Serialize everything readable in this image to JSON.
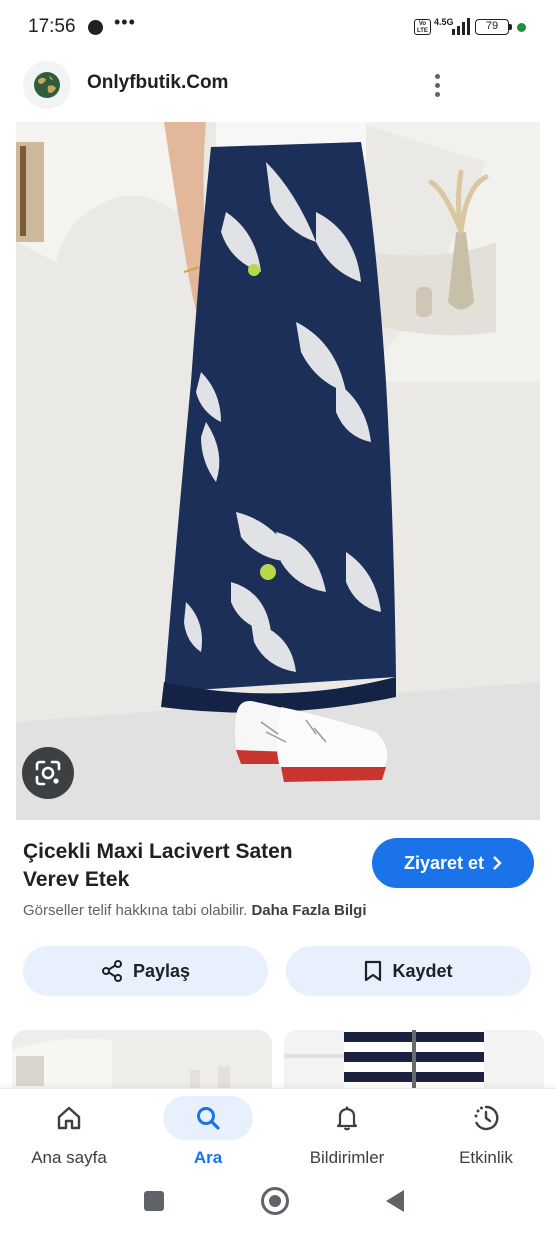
{
  "status_bar": {
    "time": "17:56",
    "more": "•••",
    "volte": "Vo LTE",
    "network": "4.5G",
    "battery": "79"
  },
  "header": {
    "site_name": "Onlyfbutik.Com",
    "logo_icon": "globe-icon",
    "menu_icon": "more-vert-icon"
  },
  "image": {
    "lens_icon": "google-lens-icon"
  },
  "product": {
    "title": "Çicekli Maxi Lacivert Saten Verev Etek",
    "visit_label": "Ziyaret et",
    "copyright_text": "Görseller telif hakkına tabi olabilir.",
    "more_info_link": "Daha Fazla Bilgi"
  },
  "actions": {
    "share_label": "Paylaş",
    "save_label": "Kaydet"
  },
  "bottom_nav": {
    "items": [
      {
        "label": "Ana sayfa",
        "icon": "home-icon"
      },
      {
        "label": "Ara",
        "icon": "search-icon"
      },
      {
        "label": "Bildirimler",
        "icon": "bell-icon"
      },
      {
        "label": "Etkinlik",
        "icon": "activity-icon"
      }
    ]
  },
  "colors": {
    "accent": "#1a73e8",
    "pill_bg": "#e8f0fe",
    "skirt": "#1c2f58"
  }
}
